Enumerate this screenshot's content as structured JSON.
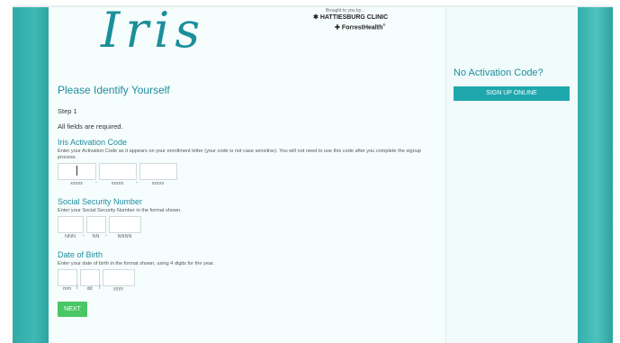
{
  "brand": {
    "logo_text": "Iris",
    "brought_by": "Brought to you by...",
    "clinic_name": "HATTIESBURG CLINIC",
    "partner_name": "ForrestHealth"
  },
  "form": {
    "title": "Please Identify Yourself",
    "step": "Step 1",
    "required_note": "All fields are required.",
    "activation": {
      "label": "Iris Activation Code",
      "description": "Enter your Activation Code as it appears on your enrollment letter (your code is not case sensitive). You will not need to use this code after you complete the signup process.",
      "hints": [
        "xxxxx",
        "xxxxx",
        "xxxxx"
      ],
      "separator": "-"
    },
    "ssn": {
      "label": "Social Security Number",
      "description": "Enter your Social Security Number in the format shown.",
      "hints": [
        "NNN",
        "NN",
        "NNNN"
      ],
      "separator": "-"
    },
    "dob": {
      "label": "Date of Birth",
      "description": "Enter your date of birth in the format shown, using 4 digits for the year.",
      "hints": [
        "mm",
        "dd",
        "yyyy"
      ],
      "separator": "/"
    },
    "next_label": "NEXT"
  },
  "sidebar": {
    "heading": "No Activation Code?",
    "signup_label": "SIGN UP ONLINE"
  }
}
